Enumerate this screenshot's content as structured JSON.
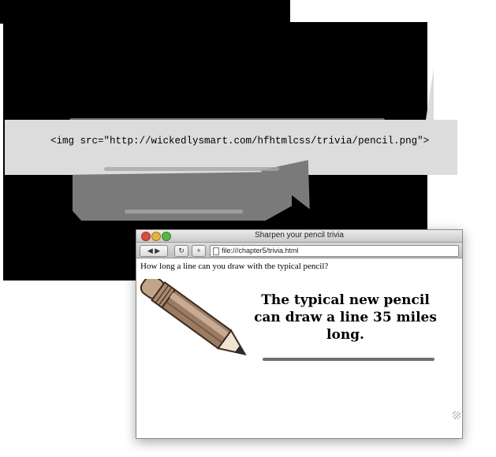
{
  "code": {
    "img_tag": "<img src=\"http://wickedlysmart.com/hfhtmlcss/trivia/pencil.png\">"
  },
  "browser": {
    "title": "Sharpen your pencil trivia",
    "url": "file:///chapter5/trivia.html",
    "back_forward_icon": "back-forward-arrows",
    "reload_icon": "reload-arrow",
    "add_icon": "plus"
  },
  "page": {
    "question": "How long a line can you draw with the typical pencil?",
    "answer": "The typical new pencil can draw a line 35 miles long."
  },
  "colors": {
    "backdrop": "#000000",
    "callout": "#dcdcdc",
    "note": "#7a7a7a",
    "line": "#6f6f6f"
  }
}
